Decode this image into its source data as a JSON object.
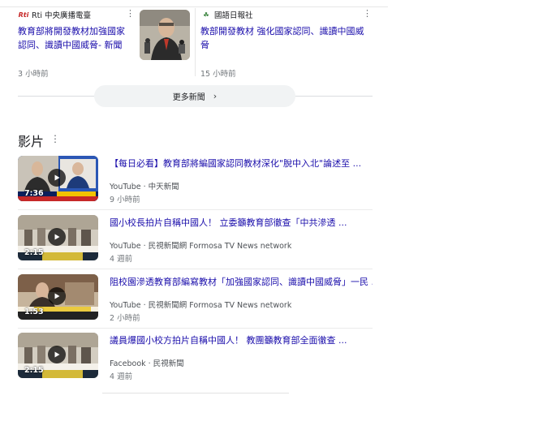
{
  "news": [
    {
      "source": "Rti 中央廣播電臺",
      "logo": "Rti",
      "title": "教育部將開發教材加強國家認同、識讀中國威脅- 新聞",
      "time": "3 小時前"
    },
    {
      "source": "國語日報社",
      "logo": "☘",
      "title": "教部開發教材 強化國家認同、識讀中國威脅",
      "time": "15 小時前"
    }
  ],
  "more_news_label": "更多新聞",
  "videos_section_title": "影片",
  "videos": [
    {
      "title": "【每日必看】教育部將編國家認同教材深化\"脫中入北\"論述至 ...",
      "platform": "YouTube",
      "channel": "中天新聞",
      "time": "9 小時前",
      "duration": "7:36",
      "thumb_colors": [
        "#2a4f9e",
        "#c8c2b6"
      ]
    },
    {
      "title": "國小校長拍片自稱中國人！ 立委籲教育部徹查「中共滲透 ...",
      "platform": "YouTube",
      "channel": "民視新聞網 Formosa TV News network",
      "time": "4 週前",
      "duration": "2:15",
      "thumb_colors": [
        "#9a8f80",
        "#d6d0c4"
      ]
    },
    {
      "title": "阻校園滲透教育部編寫教材「加強國家認同、識讀中國威脅」一民 ...",
      "platform": "YouTube",
      "channel": "民視新聞網 Formosa TV News network",
      "time": "2 小時前",
      "duration": "1:53",
      "thumb_colors": [
        "#8b6a4f",
        "#c9b79f"
      ]
    },
    {
      "title": "議員爆國小校方拍片自稱中國人！ 教團籲教育部全面徹查 ...",
      "platform": "Facebook",
      "channel": "民視新聞",
      "time": "4 週前",
      "duration": "2:15",
      "thumb_colors": [
        "#9a8f80",
        "#d6d0c4"
      ]
    }
  ]
}
